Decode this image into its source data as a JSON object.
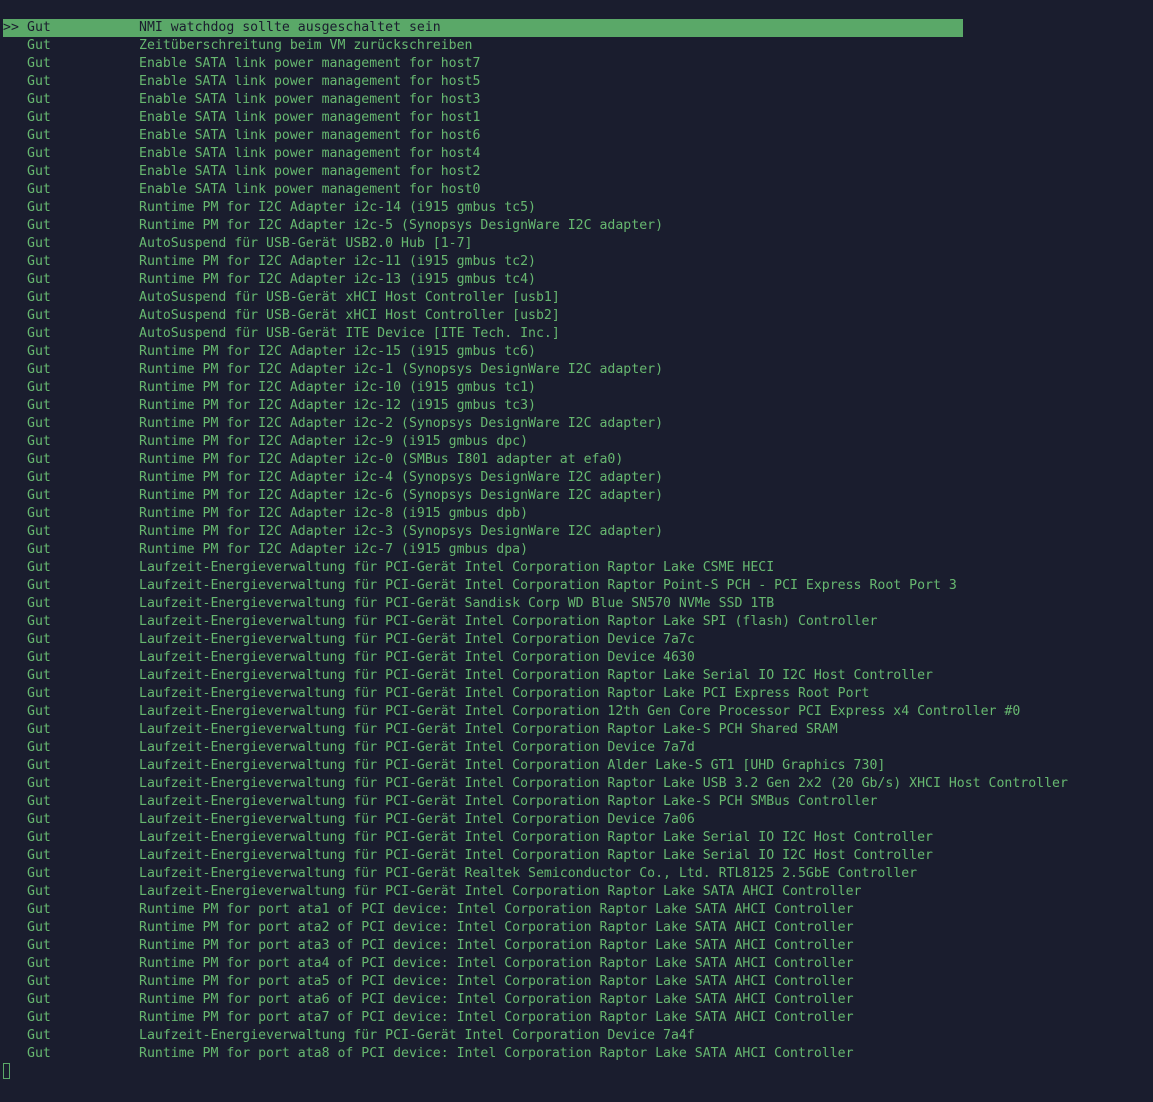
{
  "colors": {
    "background": "#1a1d2e",
    "text": "#67b870",
    "selection": "#5aa868"
  },
  "selected_marker": ">>",
  "rows": [
    {
      "status": "Gut",
      "text": "NMI watchdog sollte ausgeschaltet sein",
      "selected": true
    },
    {
      "status": "Gut",
      "text": "Zeitüberschreitung beim VM zurückschreiben"
    },
    {
      "status": "Gut",
      "text": "Enable SATA link power management for host7"
    },
    {
      "status": "Gut",
      "text": "Enable SATA link power management for host5"
    },
    {
      "status": "Gut",
      "text": "Enable SATA link power management for host3"
    },
    {
      "status": "Gut",
      "text": "Enable SATA link power management for host1"
    },
    {
      "status": "Gut",
      "text": "Enable SATA link power management for host6"
    },
    {
      "status": "Gut",
      "text": "Enable SATA link power management for host4"
    },
    {
      "status": "Gut",
      "text": "Enable SATA link power management for host2"
    },
    {
      "status": "Gut",
      "text": "Enable SATA link power management for host0"
    },
    {
      "status": "Gut",
      "text": "Runtime PM for I2C Adapter i2c-14 (i915 gmbus tc5)"
    },
    {
      "status": "Gut",
      "text": "Runtime PM for I2C Adapter i2c-5 (Synopsys DesignWare I2C adapter)"
    },
    {
      "status": "Gut",
      "text": "AutoSuspend für USB-Gerät USB2.0 Hub [1-7]"
    },
    {
      "status": "Gut",
      "text": "Runtime PM for I2C Adapter i2c-11 (i915 gmbus tc2)"
    },
    {
      "status": "Gut",
      "text": "Runtime PM for I2C Adapter i2c-13 (i915 gmbus tc4)"
    },
    {
      "status": "Gut",
      "text": "AutoSuspend für USB-Gerät xHCI Host Controller [usb1]"
    },
    {
      "status": "Gut",
      "text": "AutoSuspend für USB-Gerät xHCI Host Controller [usb2]"
    },
    {
      "status": "Gut",
      "text": "AutoSuspend für USB-Gerät ITE Device [ITE Tech. Inc.]"
    },
    {
      "status": "Gut",
      "text": "Runtime PM for I2C Adapter i2c-15 (i915 gmbus tc6)"
    },
    {
      "status": "Gut",
      "text": "Runtime PM for I2C Adapter i2c-1 (Synopsys DesignWare I2C adapter)"
    },
    {
      "status": "Gut",
      "text": "Runtime PM for I2C Adapter i2c-10 (i915 gmbus tc1)"
    },
    {
      "status": "Gut",
      "text": "Runtime PM for I2C Adapter i2c-12 (i915 gmbus tc3)"
    },
    {
      "status": "Gut",
      "text": "Runtime PM for I2C Adapter i2c-2 (Synopsys DesignWare I2C adapter)"
    },
    {
      "status": "Gut",
      "text": "Runtime PM for I2C Adapter i2c-9 (i915 gmbus dpc)"
    },
    {
      "status": "Gut",
      "text": "Runtime PM for I2C Adapter i2c-0 (SMBus I801 adapter at efa0)"
    },
    {
      "status": "Gut",
      "text": "Runtime PM for I2C Adapter i2c-4 (Synopsys DesignWare I2C adapter)"
    },
    {
      "status": "Gut",
      "text": "Runtime PM for I2C Adapter i2c-6 (Synopsys DesignWare I2C adapter)"
    },
    {
      "status": "Gut",
      "text": "Runtime PM for I2C Adapter i2c-8 (i915 gmbus dpb)"
    },
    {
      "status": "Gut",
      "text": "Runtime PM for I2C Adapter i2c-3 (Synopsys DesignWare I2C adapter)"
    },
    {
      "status": "Gut",
      "text": "Runtime PM for I2C Adapter i2c-7 (i915 gmbus dpa)"
    },
    {
      "status": "Gut",
      "text": "Laufzeit-Energieverwaltung für PCI-Gerät Intel Corporation Raptor Lake CSME HECI"
    },
    {
      "status": "Gut",
      "text": "Laufzeit-Energieverwaltung für PCI-Gerät Intel Corporation Raptor Point-S PCH - PCI Express Root Port 3"
    },
    {
      "status": "Gut",
      "text": "Laufzeit-Energieverwaltung für PCI-Gerät Sandisk Corp WD Blue SN570 NVMe SSD 1TB"
    },
    {
      "status": "Gut",
      "text": "Laufzeit-Energieverwaltung für PCI-Gerät Intel Corporation Raptor Lake SPI (flash) Controller"
    },
    {
      "status": "Gut",
      "text": "Laufzeit-Energieverwaltung für PCI-Gerät Intel Corporation Device 7a7c"
    },
    {
      "status": "Gut",
      "text": "Laufzeit-Energieverwaltung für PCI-Gerät Intel Corporation Device 4630"
    },
    {
      "status": "Gut",
      "text": "Laufzeit-Energieverwaltung für PCI-Gerät Intel Corporation Raptor Lake Serial IO I2C Host Controller"
    },
    {
      "status": "Gut",
      "text": "Laufzeit-Energieverwaltung für PCI-Gerät Intel Corporation Raptor Lake PCI Express Root Port"
    },
    {
      "status": "Gut",
      "text": "Laufzeit-Energieverwaltung für PCI-Gerät Intel Corporation 12th Gen Core Processor PCI Express x4 Controller #0"
    },
    {
      "status": "Gut",
      "text": "Laufzeit-Energieverwaltung für PCI-Gerät Intel Corporation Raptor Lake-S PCH Shared SRAM"
    },
    {
      "status": "Gut",
      "text": "Laufzeit-Energieverwaltung für PCI-Gerät Intel Corporation Device 7a7d"
    },
    {
      "status": "Gut",
      "text": "Laufzeit-Energieverwaltung für PCI-Gerät Intel Corporation Alder Lake-S GT1 [UHD Graphics 730]"
    },
    {
      "status": "Gut",
      "text": "Laufzeit-Energieverwaltung für PCI-Gerät Intel Corporation Raptor Lake USB 3.2 Gen 2x2 (20 Gb/s) XHCI Host Controller"
    },
    {
      "status": "Gut",
      "text": "Laufzeit-Energieverwaltung für PCI-Gerät Intel Corporation Raptor Lake-S PCH SMBus Controller"
    },
    {
      "status": "Gut",
      "text": "Laufzeit-Energieverwaltung für PCI-Gerät Intel Corporation Device 7a06"
    },
    {
      "status": "Gut",
      "text": "Laufzeit-Energieverwaltung für PCI-Gerät Intel Corporation Raptor Lake Serial IO I2C Host Controller"
    },
    {
      "status": "Gut",
      "text": "Laufzeit-Energieverwaltung für PCI-Gerät Intel Corporation Raptor Lake Serial IO I2C Host Controller"
    },
    {
      "status": "Gut",
      "text": "Laufzeit-Energieverwaltung für PCI-Gerät Realtek Semiconductor Co., Ltd. RTL8125 2.5GbE Controller"
    },
    {
      "status": "Gut",
      "text": "Laufzeit-Energieverwaltung für PCI-Gerät Intel Corporation Raptor Lake SATA AHCI Controller"
    },
    {
      "status": "Gut",
      "text": "Runtime PM for port ata1 of PCI device: Intel Corporation Raptor Lake SATA AHCI Controller"
    },
    {
      "status": "Gut",
      "text": "Runtime PM for port ata2 of PCI device: Intel Corporation Raptor Lake SATA AHCI Controller"
    },
    {
      "status": "Gut",
      "text": "Runtime PM for port ata3 of PCI device: Intel Corporation Raptor Lake SATA AHCI Controller"
    },
    {
      "status": "Gut",
      "text": "Runtime PM for port ata4 of PCI device: Intel Corporation Raptor Lake SATA AHCI Controller"
    },
    {
      "status": "Gut",
      "text": "Runtime PM for port ata5 of PCI device: Intel Corporation Raptor Lake SATA AHCI Controller"
    },
    {
      "status": "Gut",
      "text": "Runtime PM for port ata6 of PCI device: Intel Corporation Raptor Lake SATA AHCI Controller"
    },
    {
      "status": "Gut",
      "text": "Runtime PM for port ata7 of PCI device: Intel Corporation Raptor Lake SATA AHCI Controller"
    },
    {
      "status": "Gut",
      "text": "Laufzeit-Energieverwaltung für PCI-Gerät Intel Corporation Device 7a4f"
    },
    {
      "status": "Gut",
      "text": "Runtime PM for port ata8 of PCI device: Intel Corporation Raptor Lake SATA AHCI Controller"
    }
  ]
}
